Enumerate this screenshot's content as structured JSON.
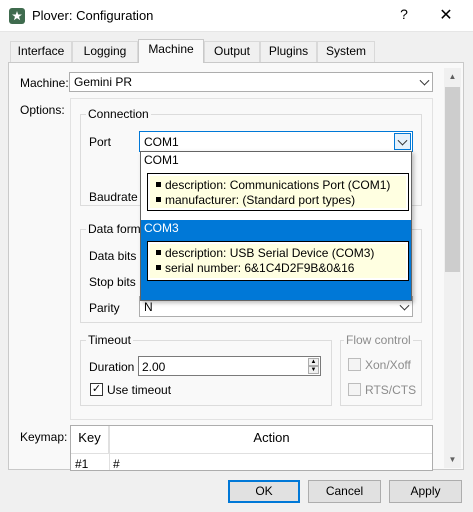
{
  "window": {
    "title": "Plover: Configuration",
    "help_label": "?",
    "close_label": "✕"
  },
  "tabs": [
    "Interface",
    "Logging",
    "Machine",
    "Output",
    "Plugins",
    "System"
  ],
  "active_tab": "Machine",
  "machine": {
    "label": "Machine:",
    "value": "Gemini PR"
  },
  "options_label": "Options:",
  "connection": {
    "title": "Connection",
    "port_label": "Port",
    "port_value": "COM1",
    "baudrate_label": "Baudrate"
  },
  "port_dropdown": {
    "items": [
      {
        "name": "COM1",
        "description": "description: Communications Port (COM1)",
        "detail": "manufacturer: (Standard port types)"
      },
      {
        "name": "COM3",
        "description": "description: USB Serial Device (COM3)",
        "detail": "serial number: 6&1C4D2F9B&0&16"
      }
    ],
    "selected": "COM3"
  },
  "data_format": {
    "title": "Data forma",
    "data_bits_label": "Data bits",
    "stop_bits_label": "Stop bits",
    "parity_label": "Parity",
    "parity_value": "N"
  },
  "timeout": {
    "title": "Timeout",
    "duration_label": "Duration",
    "duration_value": "2.00",
    "use_timeout_label": "Use timeout",
    "use_timeout_checked": true
  },
  "flow_control": {
    "title": "Flow control",
    "xon_xoff_label": "Xon/Xoff",
    "rts_cts_label": "RTS/CTS"
  },
  "keymap": {
    "label": "Keymap:",
    "columns": [
      "Key",
      "Action"
    ],
    "rows": [
      {
        "key": "#1",
        "action": "#"
      }
    ]
  },
  "buttons": {
    "ok": "OK",
    "cancel": "Cancel",
    "apply": "Apply"
  },
  "colors": {
    "accent": "#0078d7",
    "app_icon": "#3f6b4e",
    "tooltip_bg": "#ffffe1"
  }
}
